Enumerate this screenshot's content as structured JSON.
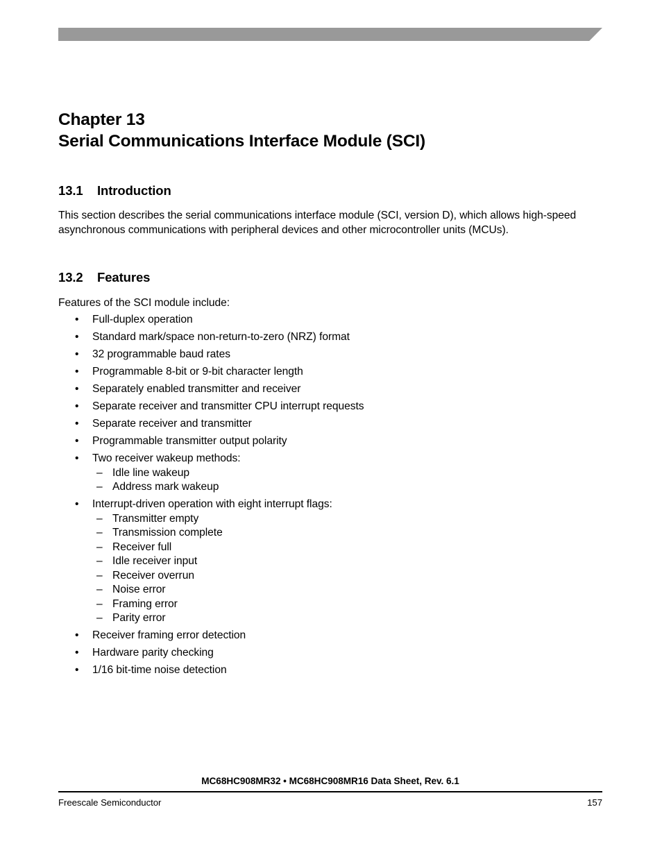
{
  "document": {
    "header_bar_color": "#999999"
  },
  "chapter": {
    "number": "Chapter 13",
    "title": "Serial Communications Interface Module (SCI)"
  },
  "sections": {
    "introduction": {
      "number": "13.1",
      "title": "Introduction",
      "paragraph": "This section describes the serial communications interface module (SCI, version D), which allows high-speed asynchronous communications with peripheral devices and other microcontroller units (MCUs)."
    },
    "features": {
      "number": "13.2",
      "title": "Features",
      "lead_in": "Features of the SCI module include:",
      "bullet_marker": "•",
      "sub_marker": "–",
      "items": [
        {
          "text": "Full-duplex operation"
        },
        {
          "text": "Standard mark/space non-return-to-zero (NRZ) format"
        },
        {
          "text": "32 programmable baud rates"
        },
        {
          "text": "Programmable 8-bit or 9-bit character length"
        },
        {
          "text": "Separately enabled transmitter and receiver"
        },
        {
          "text": "Separate receiver and transmitter CPU interrupt requests"
        },
        {
          "text": "Separate receiver and transmitter"
        },
        {
          "text": "Programmable transmitter output polarity"
        },
        {
          "text": "Two receiver wakeup methods:",
          "sub_items": [
            {
              "text": "Idle line wakeup"
            },
            {
              "text": "Address mark wakeup"
            }
          ]
        },
        {
          "text": "Interrupt-driven operation with eight interrupt flags:",
          "sub_items": [
            {
              "text": "Transmitter empty"
            },
            {
              "text": "Transmission complete"
            },
            {
              "text": "Receiver full"
            },
            {
              "text": "Idle receiver input"
            },
            {
              "text": "Receiver overrun"
            },
            {
              "text": "Noise error"
            },
            {
              "text": "Framing error"
            },
            {
              "text": "Parity error"
            }
          ]
        },
        {
          "text": "Receiver framing error detection"
        },
        {
          "text": "Hardware parity checking"
        },
        {
          "text": "1/16 bit-time noise detection"
        }
      ]
    }
  },
  "footer": {
    "title": "MC68HC908MR32 • MC68HC908MR16 Data Sheet, Rev. 6.1",
    "company": "Freescale Semiconductor",
    "page_number": "157"
  }
}
